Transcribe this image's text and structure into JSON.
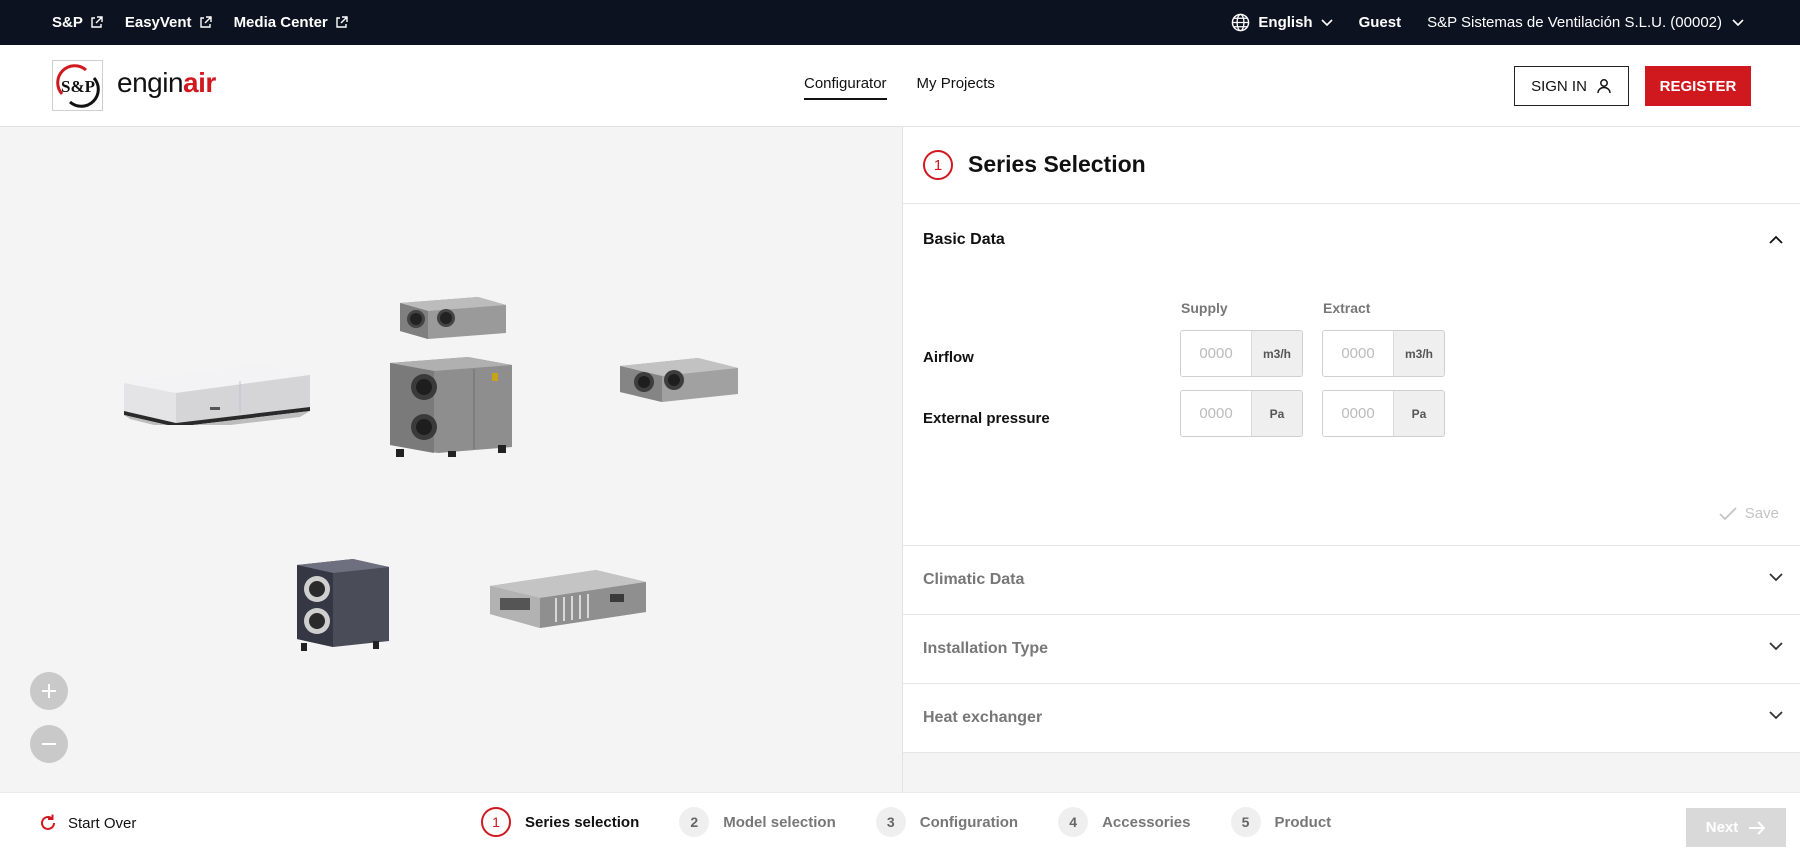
{
  "topbar": {
    "links": [
      {
        "label": "S&P",
        "icon": "external-link-icon"
      },
      {
        "label": "EasyVent",
        "icon": "external-link-icon"
      },
      {
        "label": "Media Center",
        "icon": "external-link-icon"
      }
    ],
    "language": "English",
    "user": "Guest",
    "company": "S&P Sistemas de Ventilación S.L.U. (00002)"
  },
  "header": {
    "logo_text": "S&P",
    "brand_part1": "engin",
    "brand_part2": "air",
    "nav": [
      {
        "label": "Configurator",
        "active": true
      },
      {
        "label": "My Projects",
        "active": false
      }
    ],
    "sign_in": "SIGN IN",
    "register": "REGISTER"
  },
  "viewer": {
    "zoom_in": "+",
    "zoom_out": "–",
    "products": [
      "ceiling-unit",
      "compact-duct-unit",
      "vertical-ahu",
      "flat-duct-unit",
      "dark-vertical-unit",
      "slim-duct-unit"
    ]
  },
  "panel": {
    "step_number": "1",
    "title": "Series Selection",
    "basic": {
      "title": "Basic Data",
      "col_supply": "Supply",
      "col_extract": "Extract",
      "rows": [
        {
          "label": "Airflow",
          "supply_placeholder": "0000",
          "extract_placeholder": "0000",
          "unit": "m3/h"
        },
        {
          "label": "External pressure",
          "supply_placeholder": "0000",
          "extract_placeholder": "0000",
          "unit": "Pa"
        }
      ],
      "save": "Save"
    },
    "sections": [
      "Climatic Data",
      "Installation Type",
      "Heat exchanger"
    ]
  },
  "bottombar": {
    "start_over": "Start Over",
    "steps": [
      {
        "num": "1",
        "label": "Series selection",
        "active": true
      },
      {
        "num": "2",
        "label": "Model selection",
        "active": false
      },
      {
        "num": "3",
        "label": "Configuration",
        "active": false
      },
      {
        "num": "4",
        "label": "Accessories",
        "active": false
      },
      {
        "num": "5",
        "label": "Product",
        "active": false
      }
    ],
    "next": "Next"
  },
  "colors": {
    "accent": "#d0191f",
    "topbar": "#0d1221",
    "panel_bg": "#f4f4f4"
  }
}
